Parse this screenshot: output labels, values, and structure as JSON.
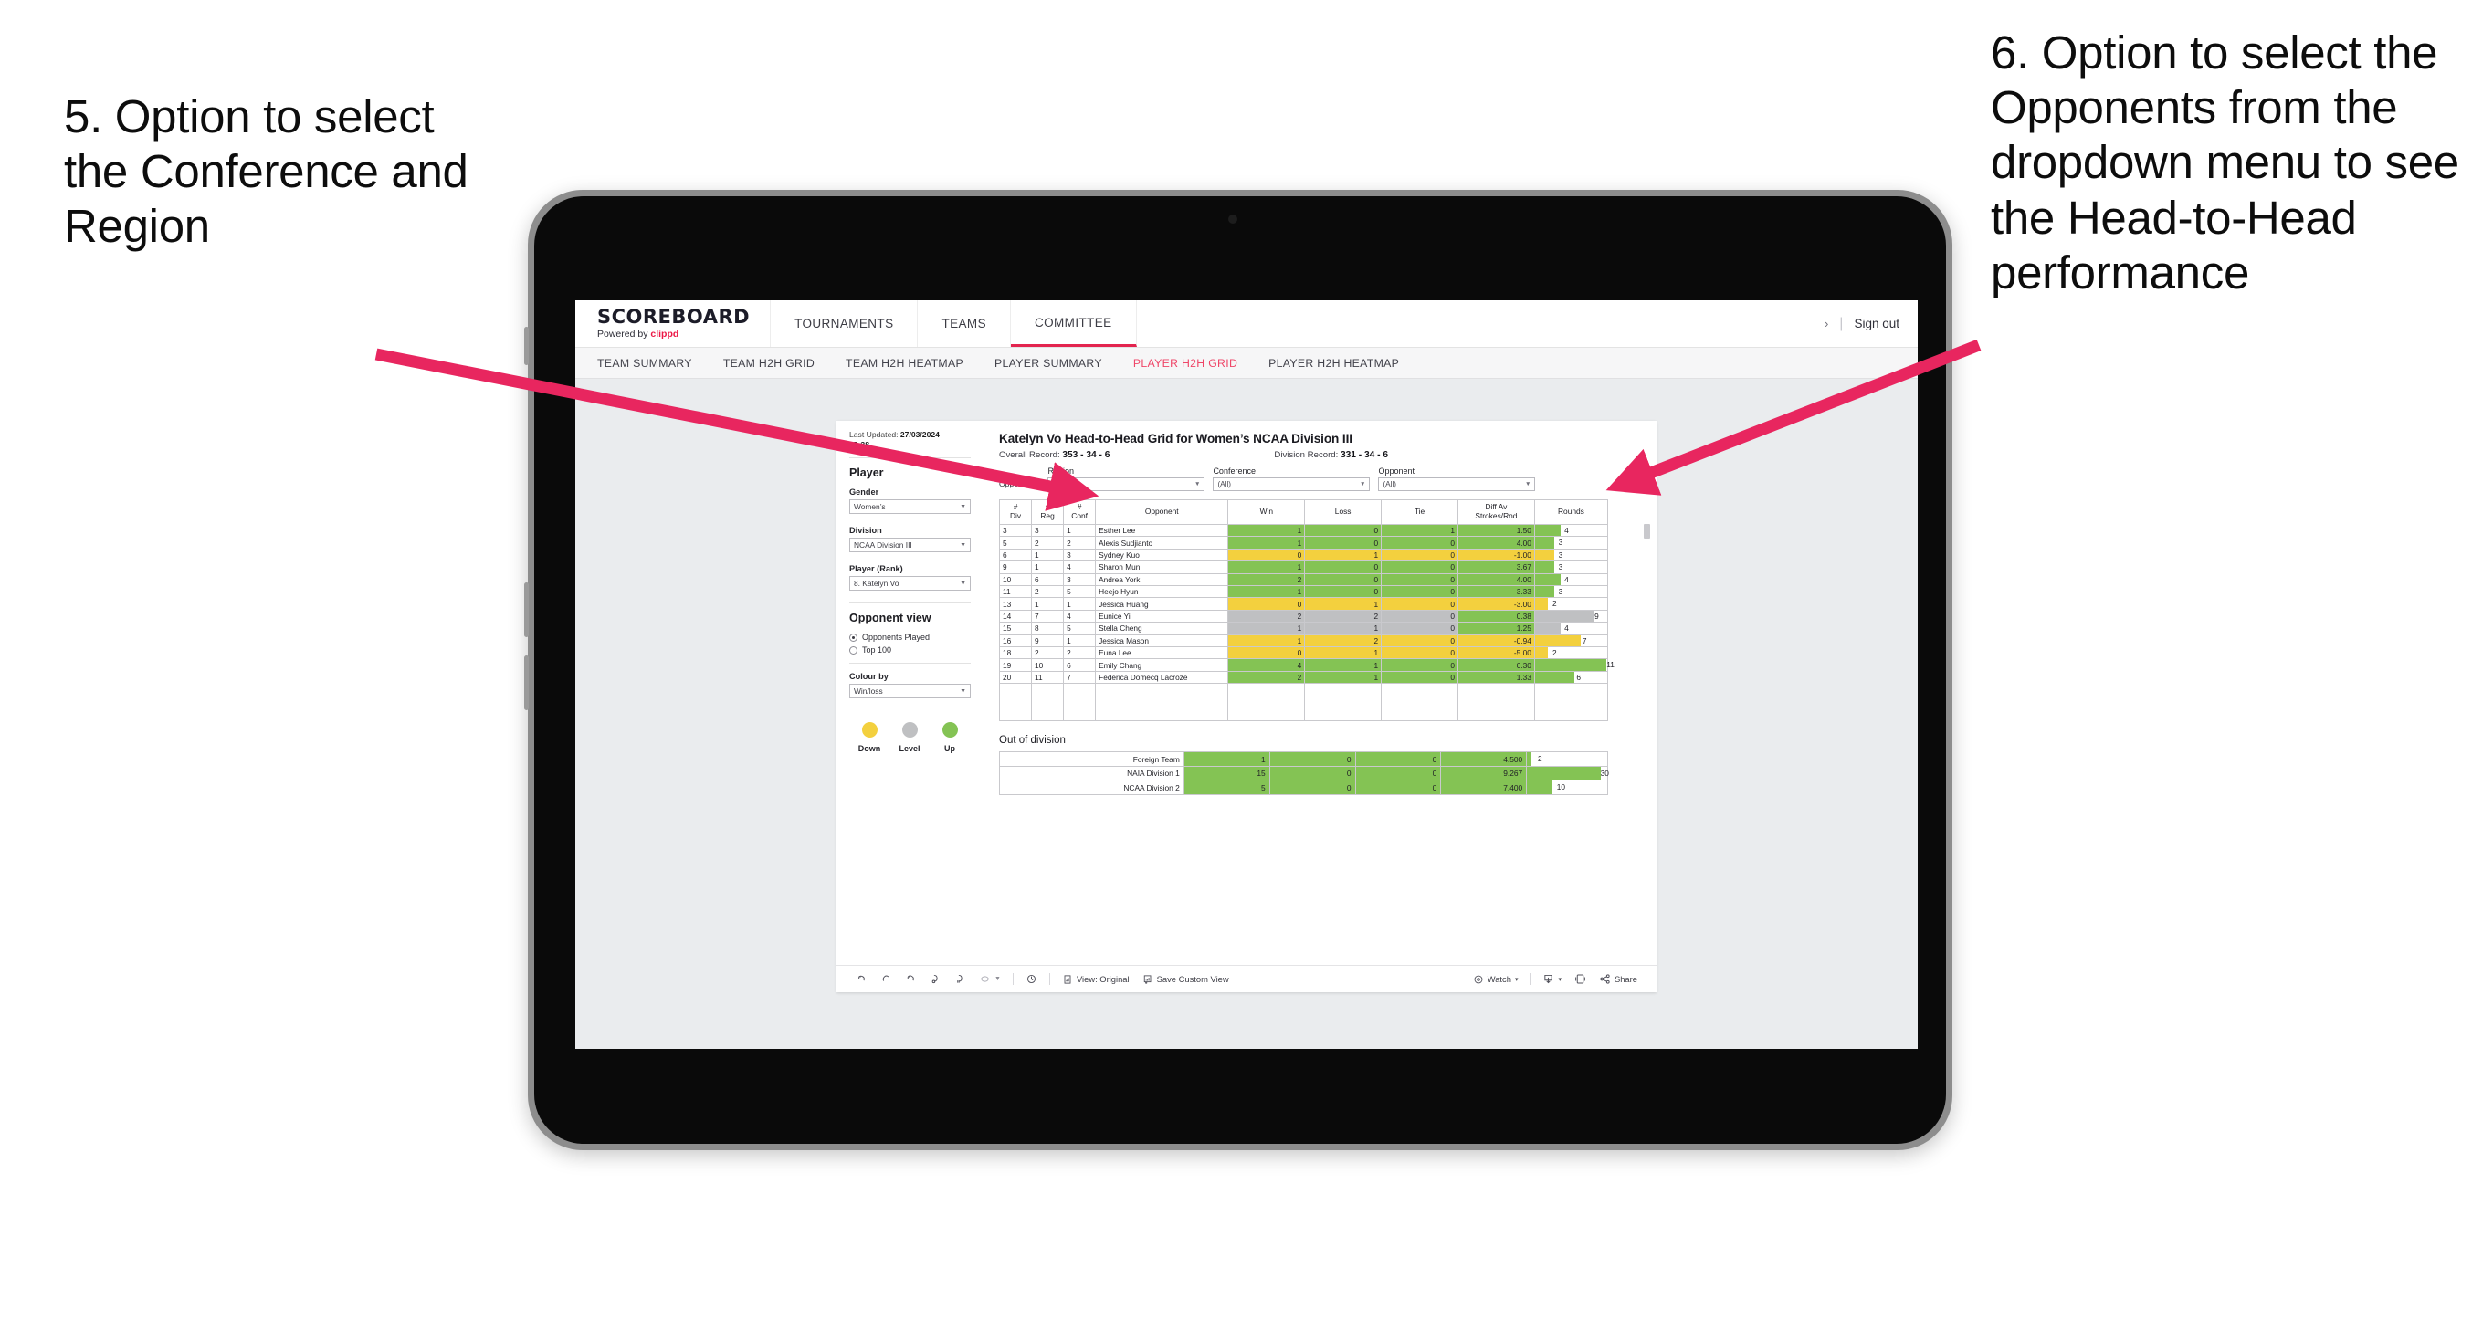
{
  "annotations": {
    "left": "5. Option to select the Conference and Region",
    "right": "6. Option to select the Opponents from the dropdown menu to see the Head-to-Head performance",
    "arrow_color": "#E8265F"
  },
  "app": {
    "brand_name": "SCOREBOARD",
    "brand_powered_prefix": "Powered by ",
    "brand_powered_name": "clippd",
    "nav_items": [
      {
        "label": "TOURNAMENTS",
        "active": false
      },
      {
        "label": "TEAMS",
        "active": false
      },
      {
        "label": "COMMITTEE",
        "active": true
      }
    ],
    "nav_right": {
      "chevron": "›",
      "separator": "|",
      "sign_out": "Sign out"
    },
    "sub_nav": [
      {
        "label": "TEAM SUMMARY",
        "active": false
      },
      {
        "label": "TEAM H2H GRID",
        "active": false
      },
      {
        "label": "TEAM H2H HEATMAP",
        "active": false
      },
      {
        "label": "PLAYER SUMMARY",
        "active": false
      },
      {
        "label": "PLAYER H2H GRID",
        "active": true
      },
      {
        "label": "PLAYER H2H HEATMAP",
        "active": false
      }
    ]
  },
  "panel": {
    "last_updated_label": "Last Updated: ",
    "last_updated_value": "27/03/2024",
    "last_updated_time": "15:38",
    "player_title": "Player",
    "gender_label": "Gender",
    "gender_value": "Women’s",
    "division_label": "Division",
    "division_value": "NCAA Division III",
    "player_rank_label": "Player (Rank)",
    "player_rank_value": "8. Katelyn Vo",
    "opponent_view_title": "Opponent view",
    "opponent_view_options": [
      {
        "label": "Opponents Played",
        "selected": true
      },
      {
        "label": "Top 100",
        "selected": false
      }
    ],
    "colour_by_label": "Colour by",
    "colour_by_value": "Win/loss",
    "legend": [
      {
        "label": "Down",
        "color": "#F3D03E"
      },
      {
        "label": "Level",
        "color": "#BFC0C2"
      },
      {
        "label": "Up",
        "color": "#84C354"
      }
    ]
  },
  "main": {
    "title": "Katelyn Vo Head-to-Head Grid for Women’s NCAA Division III",
    "overall_record_label": "Overall Record: ",
    "overall_record_value": "353 - 34 - 6",
    "division_record_label": "Division Record: ",
    "division_record_value": "331 - 34 - 6",
    "opponents_label": "Opponents:",
    "filters": [
      {
        "label": "Region",
        "value": "(All)"
      },
      {
        "label": "Conference",
        "value": "(All)"
      },
      {
        "label": "Opponent",
        "value": "(All)"
      }
    ],
    "out_of_division_title": "Out of division"
  },
  "chart_data": {
    "type": "table",
    "title": "Katelyn Vo Head-to-Head Grid for Women’s NCAA Division III",
    "columns": [
      "# Div",
      "# Reg",
      "# Conf",
      "Opponent",
      "Win",
      "Loss",
      "Tie",
      "Diff Av Strokes/Rnd",
      "Rounds"
    ],
    "column_headers_multiline": [
      [
        "#",
        "Div"
      ],
      [
        "#",
        "Reg"
      ],
      [
        "#",
        "Conf"
      ],
      [
        "Opponent"
      ],
      [
        "Win"
      ],
      [
        "Loss"
      ],
      [
        "Tie"
      ],
      [
        "Diff Av",
        "Strokes/Rnd"
      ],
      [
        "Rounds"
      ]
    ],
    "rows": [
      {
        "div": "3",
        "reg": "3",
        "conf": "1",
        "opponent": "Esther Lee",
        "win": "1",
        "loss": "0",
        "tie": "1",
        "diff": "1.50",
        "rounds": "4",
        "fill": "#84C354",
        "bar_pct": 36
      },
      {
        "div": "5",
        "reg": "2",
        "conf": "2",
        "opponent": "Alexis Sudjianto",
        "win": "1",
        "loss": "0",
        "tie": "0",
        "diff": "4.00",
        "rounds": "3",
        "fill": "#84C354",
        "bar_pct": 27
      },
      {
        "div": "6",
        "reg": "1",
        "conf": "3",
        "opponent": "Sydney Kuo",
        "win": "0",
        "loss": "1",
        "tie": "0",
        "diff": "-1.00",
        "rounds": "3",
        "fill": "#F3D03E",
        "bar_pct": 27
      },
      {
        "div": "9",
        "reg": "1",
        "conf": "4",
        "opponent": "Sharon Mun",
        "win": "1",
        "loss": "0",
        "tie": "0",
        "diff": "3.67",
        "rounds": "3",
        "fill": "#84C354",
        "bar_pct": 27
      },
      {
        "div": "10",
        "reg": "6",
        "conf": "3",
        "opponent": "Andrea York",
        "win": "2",
        "loss": "0",
        "tie": "0",
        "diff": "4.00",
        "rounds": "4",
        "fill": "#84C354",
        "bar_pct": 36
      },
      {
        "div": "11",
        "reg": "2",
        "conf": "5",
        "opponent": "Heejo Hyun",
        "win": "1",
        "loss": "0",
        "tie": "0",
        "diff": "3.33",
        "rounds": "3",
        "fill": "#84C354",
        "bar_pct": 27
      },
      {
        "div": "13",
        "reg": "1",
        "conf": "1",
        "opponent": "Jessica Huang",
        "win": "0",
        "loss": "1",
        "tie": "0",
        "diff": "-3.00",
        "rounds": "2",
        "fill": "#F3D03E",
        "bar_pct": 18
      },
      {
        "div": "14",
        "reg": "7",
        "conf": "4",
        "opponent": "Eunice Yi",
        "win": "2",
        "loss": "2",
        "tie": "0",
        "diff": "0.38",
        "rounds": "9",
        "fill": "#BFC0C2",
        "diff_fill": "#84C354",
        "bar_pct": 81
      },
      {
        "div": "15",
        "reg": "8",
        "conf": "5",
        "opponent": "Stella Cheng",
        "win": "1",
        "loss": "1",
        "tie": "0",
        "diff": "1.25",
        "rounds": "4",
        "fill": "#BFC0C2",
        "diff_fill": "#84C354",
        "bar_pct": 36
      },
      {
        "div": "16",
        "reg": "9",
        "conf": "1",
        "opponent": "Jessica Mason",
        "win": "1",
        "loss": "2",
        "tie": "0",
        "diff": "-0.94",
        "rounds": "7",
        "fill": "#F3D03E",
        "bar_pct": 63
      },
      {
        "div": "18",
        "reg": "2",
        "conf": "2",
        "opponent": "Euna Lee",
        "win": "0",
        "loss": "1",
        "tie": "0",
        "diff": "-5.00",
        "rounds": "2",
        "fill": "#F3D03E",
        "bar_pct": 18
      },
      {
        "div": "19",
        "reg": "10",
        "conf": "6",
        "opponent": "Emily Chang",
        "win": "4",
        "loss": "1",
        "tie": "0",
        "diff": "0.30",
        "rounds": "11",
        "fill": "#84C354",
        "bar_pct": 99
      },
      {
        "div": "20",
        "reg": "11",
        "conf": "7",
        "opponent": "Federica Domecq Lacroze",
        "win": "2",
        "loss": "1",
        "tie": "0",
        "diff": "1.33",
        "rounds": "6",
        "fill": "#84C354",
        "bar_pct": 54
      }
    ],
    "out_of_division": {
      "title": "Out of division",
      "rows": [
        {
          "name": "Foreign Team",
          "win": "1",
          "loss": "0",
          "tie": "0",
          "diff": "4.500",
          "rounds": "2",
          "fill": "#84C354",
          "bar_pct": 6
        },
        {
          "name": "NAIA Division 1",
          "win": "15",
          "loss": "0",
          "tie": "0",
          "diff": "9.267",
          "rounds": "30",
          "fill": "#84C354",
          "bar_pct": 92
        },
        {
          "name": "NCAA Division 2",
          "win": "5",
          "loss": "0",
          "tie": "0",
          "diff": "7.400",
          "rounds": "10",
          "fill": "#84C354",
          "bar_pct": 32
        }
      ]
    }
  },
  "toolbar": {
    "view_label": "View: Original",
    "save_label": "Save Custom View",
    "watch_label": "Watch",
    "share_label": "Share",
    "caret": "▾"
  }
}
